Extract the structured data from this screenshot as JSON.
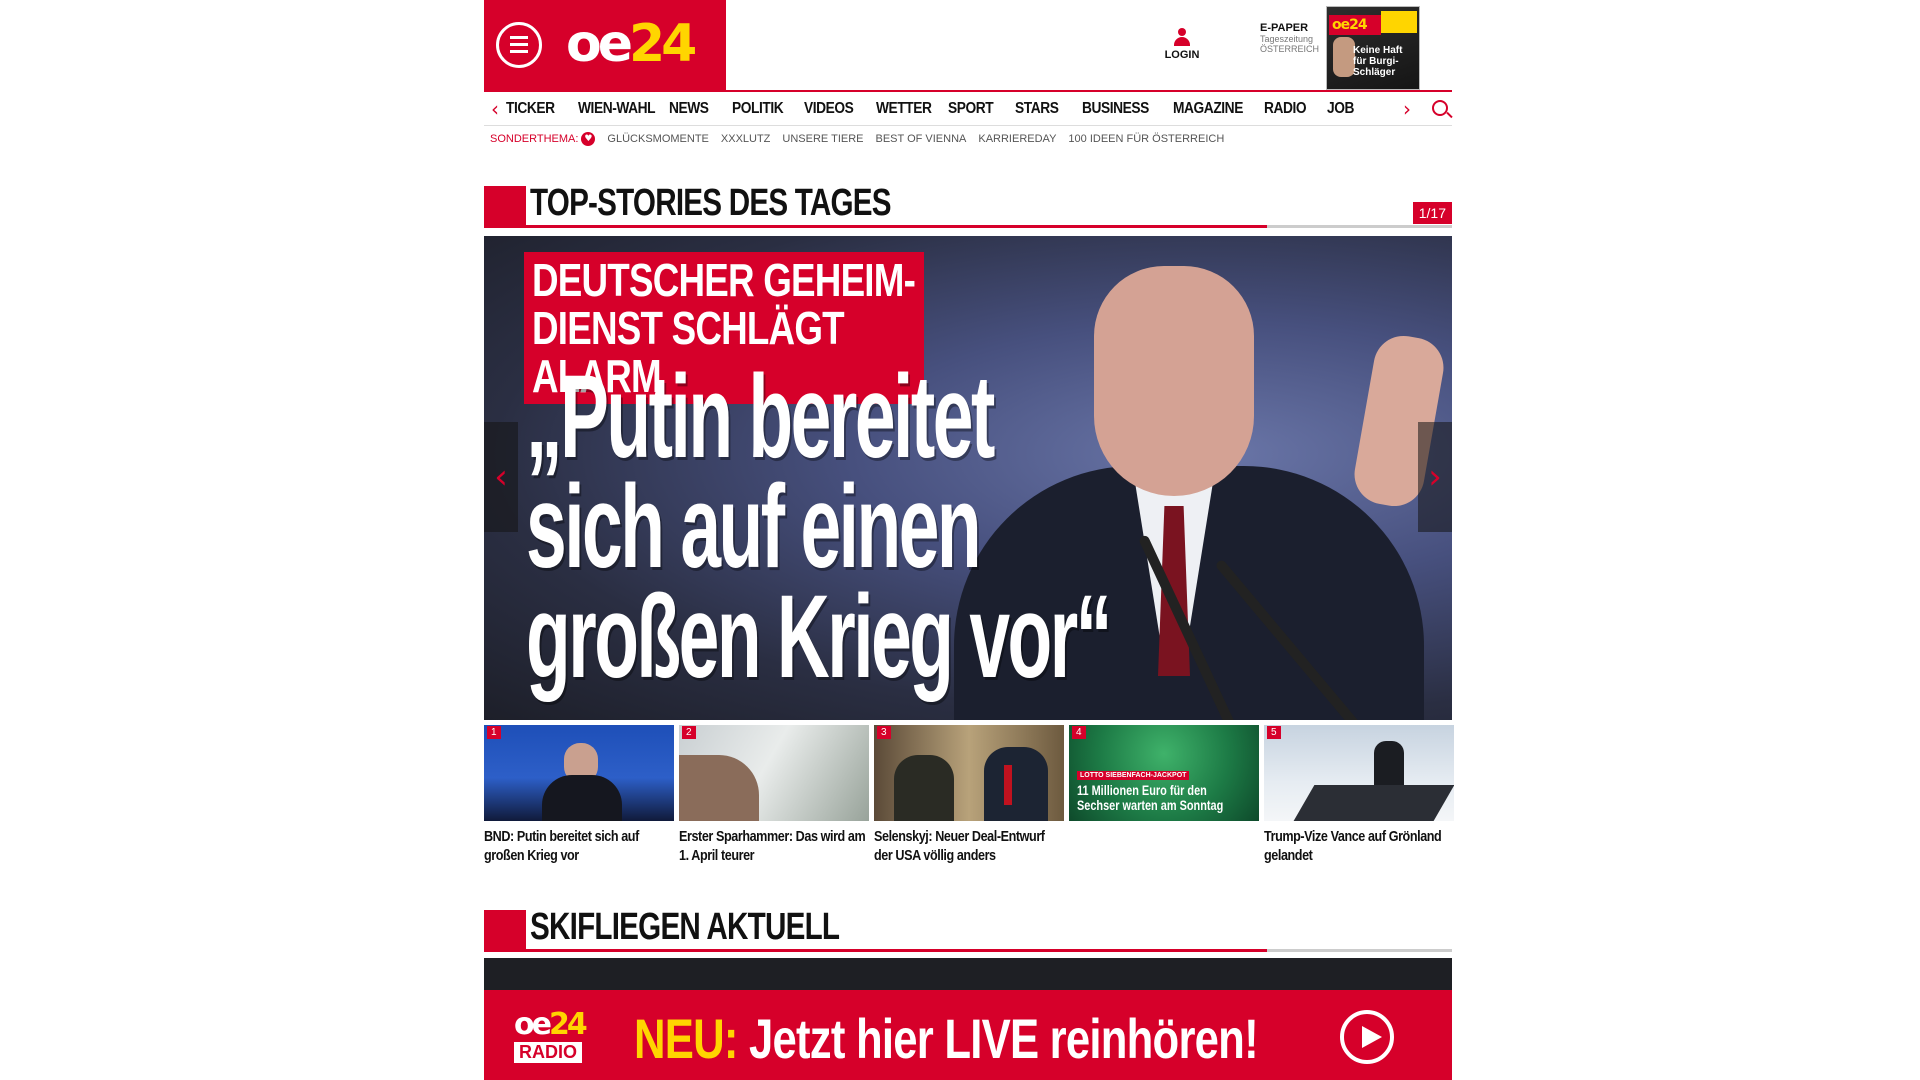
{
  "header": {
    "brand_main": "oe",
    "brand_accent": "24",
    "login_label": "LOGIN",
    "epaper": {
      "title": "E-PAPER",
      "line1": "Tageszeitung",
      "line2": "ÖSTERREICH",
      "cover_headline": "Keine Haft für Burgi-Schläger"
    }
  },
  "nav": {
    "items": [
      "TICKER",
      "WIEN-WAHL",
      "NEWS",
      "POLITIK",
      "VIDEOS",
      "WETTER",
      "SPORT",
      "STARS",
      "BUSINESS",
      "MAGAZINE",
      "RADIO",
      "JOB"
    ]
  },
  "subnav": {
    "lead": "SONDERTHEMA:",
    "items": [
      "GLÜCKSMOMENTE",
      "XXXLUTZ",
      "UNSERE TIERE",
      "BEST OF VIENNA",
      "KARRIEREDAY",
      "100 IDEEN FÜR ÖSTERREICH"
    ]
  },
  "top_stories": {
    "title": "TOP-STORIES DES TAGES",
    "counter": "1/17",
    "hero": {
      "kicker": "DEUTSCHER GEHEIM-DIENST SCHLÄGT ALARM",
      "headline": "„Putin bereitet sich auf einen großen Krieg vor“"
    },
    "teasers": [
      {
        "num": "1",
        "caption": "BND: Putin bereitet sich auf großen Krieg vor"
      },
      {
        "num": "2",
        "caption": "Erster Sparhammer: Das wird am 1. April teurer"
      },
      {
        "num": "3",
        "caption": "Selenskyj: Neuer Deal-Entwurf der USA völlig anders"
      },
      {
        "num": "4",
        "caption": "",
        "overlay_tag": "LOTTO SIEBENFACH-JACKPOT",
        "overlay_text": "11 Millionen Euro für den Sechser warten am Sonntag"
      },
      {
        "num": "5",
        "caption": "Trump-Vize Vance auf Grönland gelandet"
      }
    ]
  },
  "section2": {
    "title": "SKIFLIEGEN AKTUELL"
  },
  "radio_banner": {
    "logo_main": "oe",
    "logo_accent": "24",
    "logo_radio": "RADIO",
    "text_accent": "NEU:",
    "text_main": "Jetzt hier LIVE reinhören!"
  },
  "colors": {
    "brand_red": "#d6002a",
    "brand_yellow": "#ffd500"
  }
}
